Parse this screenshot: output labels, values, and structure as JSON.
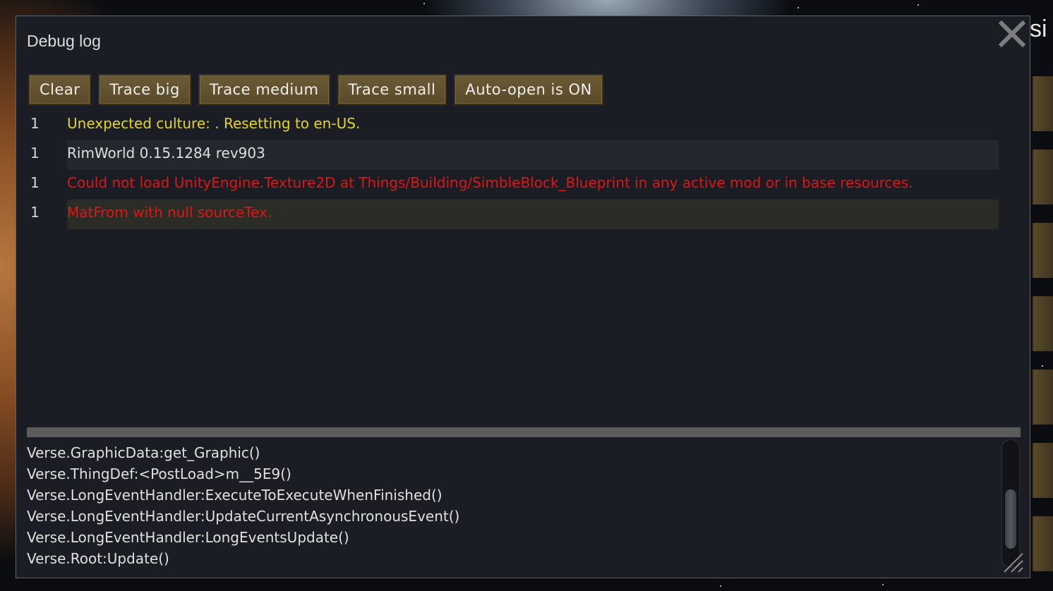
{
  "window": {
    "title": "Debug log",
    "corner_label": "si"
  },
  "toolbar": {
    "buttons": [
      {
        "label": "Clear"
      },
      {
        "label": "Trace big"
      },
      {
        "label": "Trace medium"
      },
      {
        "label": "Trace small"
      },
      {
        "label": "Auto-open is ON"
      }
    ]
  },
  "log": {
    "entries": [
      {
        "count": "1",
        "message": "Unexpected culture: . Resetting to en-US.",
        "level": "warning",
        "color": "#e6d51e"
      },
      {
        "count": "1",
        "message": "RimWorld 0.15.1284 rev903",
        "level": "info",
        "color": "#dedede"
      },
      {
        "count": "1",
        "message": "Could not load UnityEngine.Texture2D at Things/Building/SimbleBlock_Blueprint in any active mod or in base resources.",
        "level": "error",
        "color": "#e01515"
      },
      {
        "count": "1",
        "message": "MatFrom with null sourceTex.",
        "level": "error",
        "color": "#e01515"
      }
    ],
    "selected_index": 3
  },
  "stack_trace": {
    "lines": [
      "Verse.GraphicData:get_Graphic()",
      "Verse.ThingDef:<PostLoad>m__5E9()",
      "Verse.LongEventHandler:ExecuteToExecuteWhenFinished()",
      "Verse.LongEventHandler:UpdateCurrentAsynchronousEvent()",
      "Verse.LongEventHandler:LongEventsUpdate()",
      "Verse.Root:Update()"
    ]
  },
  "icons": {
    "close": "close-icon",
    "resize": "resize-grip-icon"
  },
  "colors": {
    "window_bg": "#1a1e24",
    "button_bg": "#5a4a2a",
    "warning": "#e6d51e",
    "error": "#e01515"
  }
}
